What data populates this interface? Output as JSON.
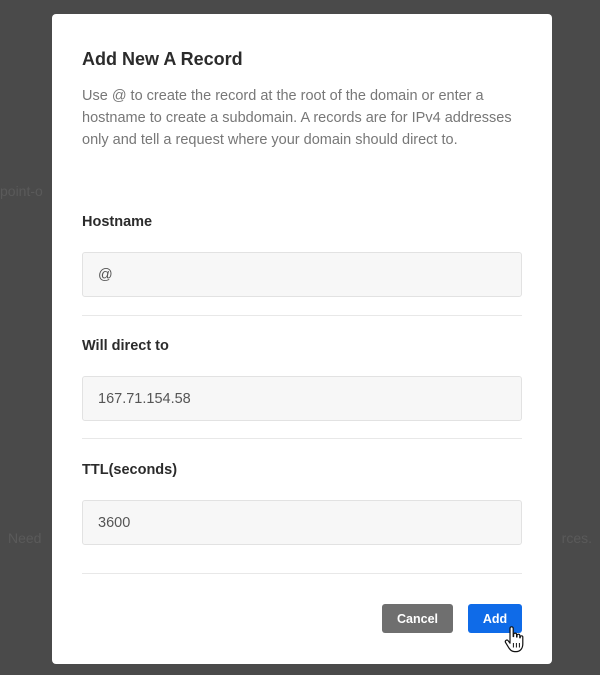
{
  "background": {
    "left_text_1": "point-o",
    "left_text_2": "Need",
    "right_text_1": "",
    "right_text_2": "rces."
  },
  "modal": {
    "title": "Add New A Record",
    "description": "Use @ to create the record at the root of the domain or enter a hostname to create a subdomain. A records are for IPv4 addresses only and tell a request where your domain should direct to.",
    "fields": {
      "hostname": {
        "label": "Hostname",
        "value": "@",
        "placeholder": ""
      },
      "direct_to": {
        "label": "Will direct to",
        "value": "167.71.154.58",
        "placeholder": ""
      },
      "ttl": {
        "label": "TTL(seconds)",
        "value": "3600",
        "placeholder": ""
      }
    },
    "buttons": {
      "cancel_label": "Cancel",
      "add_label": "Add"
    }
  },
  "colors": {
    "primary": "#0f6be8",
    "secondary_button": "#6f6f6f",
    "overlay": "#4a4a4a"
  },
  "icons": {
    "cursor": "hand-pointer-icon"
  }
}
